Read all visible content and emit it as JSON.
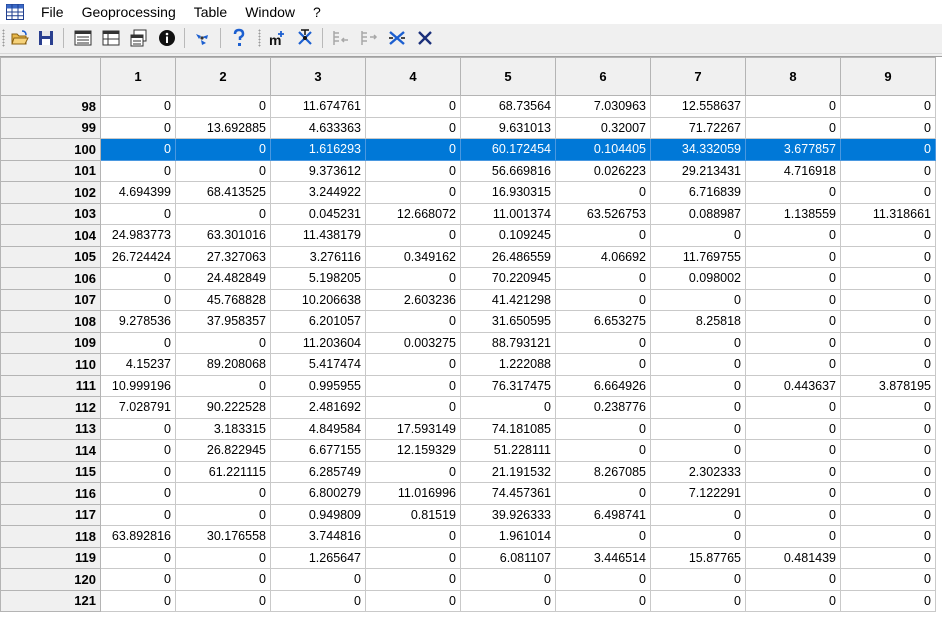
{
  "menu": [
    "File",
    "Geoprocessing",
    "Table",
    "Window",
    "?"
  ],
  "columns": [
    "1",
    "2",
    "3",
    "4",
    "5",
    "6",
    "7",
    "8",
    "9"
  ],
  "selected_row": "100",
  "rows": [
    {
      "id": "98",
      "cells": [
        "0",
        "0",
        "11.674761",
        "0",
        "68.73564",
        "7.030963",
        "12.558637",
        "0",
        "0"
      ]
    },
    {
      "id": "99",
      "cells": [
        "0",
        "13.692885",
        "4.633363",
        "0",
        "9.631013",
        "0.32007",
        "71.72267",
        "0",
        "0"
      ]
    },
    {
      "id": "100",
      "cells": [
        "0",
        "0",
        "1.616293",
        "0",
        "60.172454",
        "0.104405",
        "34.332059",
        "3.677857",
        "0"
      ]
    },
    {
      "id": "101",
      "cells": [
        "0",
        "0",
        "9.373612",
        "0",
        "56.669816",
        "0.026223",
        "29.213431",
        "4.716918",
        "0"
      ]
    },
    {
      "id": "102",
      "cells": [
        "4.694399",
        "68.413525",
        "3.244922",
        "0",
        "16.930315",
        "0",
        "6.716839",
        "0",
        "0"
      ]
    },
    {
      "id": "103",
      "cells": [
        "0",
        "0",
        "0.045231",
        "12.668072",
        "11.001374",
        "63.526753",
        "0.088987",
        "1.138559",
        "11.318661"
      ]
    },
    {
      "id": "104",
      "cells": [
        "24.983773",
        "63.301016",
        "11.438179",
        "0",
        "0.109245",
        "0",
        "0",
        "0",
        "0"
      ]
    },
    {
      "id": "105",
      "cells": [
        "26.724424",
        "27.327063",
        "3.276116",
        "0.349162",
        "26.486559",
        "4.06692",
        "11.769755",
        "0",
        "0"
      ]
    },
    {
      "id": "106",
      "cells": [
        "0",
        "24.482849",
        "5.198205",
        "0",
        "70.220945",
        "0",
        "0.098002",
        "0",
        "0"
      ]
    },
    {
      "id": "107",
      "cells": [
        "0",
        "45.768828",
        "10.206638",
        "2.603236",
        "41.421298",
        "0",
        "0",
        "0",
        "0"
      ]
    },
    {
      "id": "108",
      "cells": [
        "9.278536",
        "37.958357",
        "6.201057",
        "0",
        "31.650595",
        "6.653275",
        "8.25818",
        "0",
        "0"
      ]
    },
    {
      "id": "109",
      "cells": [
        "0",
        "0",
        "11.203604",
        "0.003275",
        "88.793121",
        "0",
        "0",
        "0",
        "0"
      ]
    },
    {
      "id": "110",
      "cells": [
        "4.15237",
        "89.208068",
        "5.417474",
        "0",
        "1.222088",
        "0",
        "0",
        "0",
        "0"
      ]
    },
    {
      "id": "111",
      "cells": [
        "10.999196",
        "0",
        "0.995955",
        "0",
        "76.317475",
        "6.664926",
        "0",
        "0.443637",
        "3.878195"
      ]
    },
    {
      "id": "112",
      "cells": [
        "7.028791",
        "90.222528",
        "2.481692",
        "0",
        "0",
        "0.238776",
        "0",
        "0",
        "0"
      ]
    },
    {
      "id": "113",
      "cells": [
        "0",
        "3.183315",
        "4.849584",
        "17.593149",
        "74.181085",
        "0",
        "0",
        "0",
        "0"
      ]
    },
    {
      "id": "114",
      "cells": [
        "0",
        "26.822945",
        "6.677155",
        "12.159329",
        "51.228111",
        "0",
        "0",
        "0",
        "0"
      ]
    },
    {
      "id": "115",
      "cells": [
        "0",
        "61.221115",
        "6.285749",
        "0",
        "21.191532",
        "8.267085",
        "2.302333",
        "0",
        "0"
      ]
    },
    {
      "id": "116",
      "cells": [
        "0",
        "0",
        "6.800279",
        "11.016996",
        "74.457361",
        "0",
        "7.122291",
        "0",
        "0"
      ]
    },
    {
      "id": "117",
      "cells": [
        "0",
        "0",
        "0.949809",
        "0.81519",
        "39.926333",
        "6.498741",
        "0",
        "0",
        "0"
      ]
    },
    {
      "id": "118",
      "cells": [
        "63.892816",
        "30.176558",
        "3.744816",
        "0",
        "1.961014",
        "0",
        "0",
        "0",
        "0"
      ]
    },
    {
      "id": "119",
      "cells": [
        "0",
        "0",
        "1.265647",
        "0",
        "6.081107",
        "3.446514",
        "15.87765",
        "0.481439",
        "0"
      ]
    },
    {
      "id": "120",
      "cells": [
        "0",
        "0",
        "0",
        "0",
        "0",
        "0",
        "0",
        "0",
        "0"
      ]
    },
    {
      "id": "121",
      "cells": [
        "0",
        "0",
        "0",
        "0",
        "0",
        "0",
        "0",
        "0",
        "0"
      ]
    }
  ]
}
